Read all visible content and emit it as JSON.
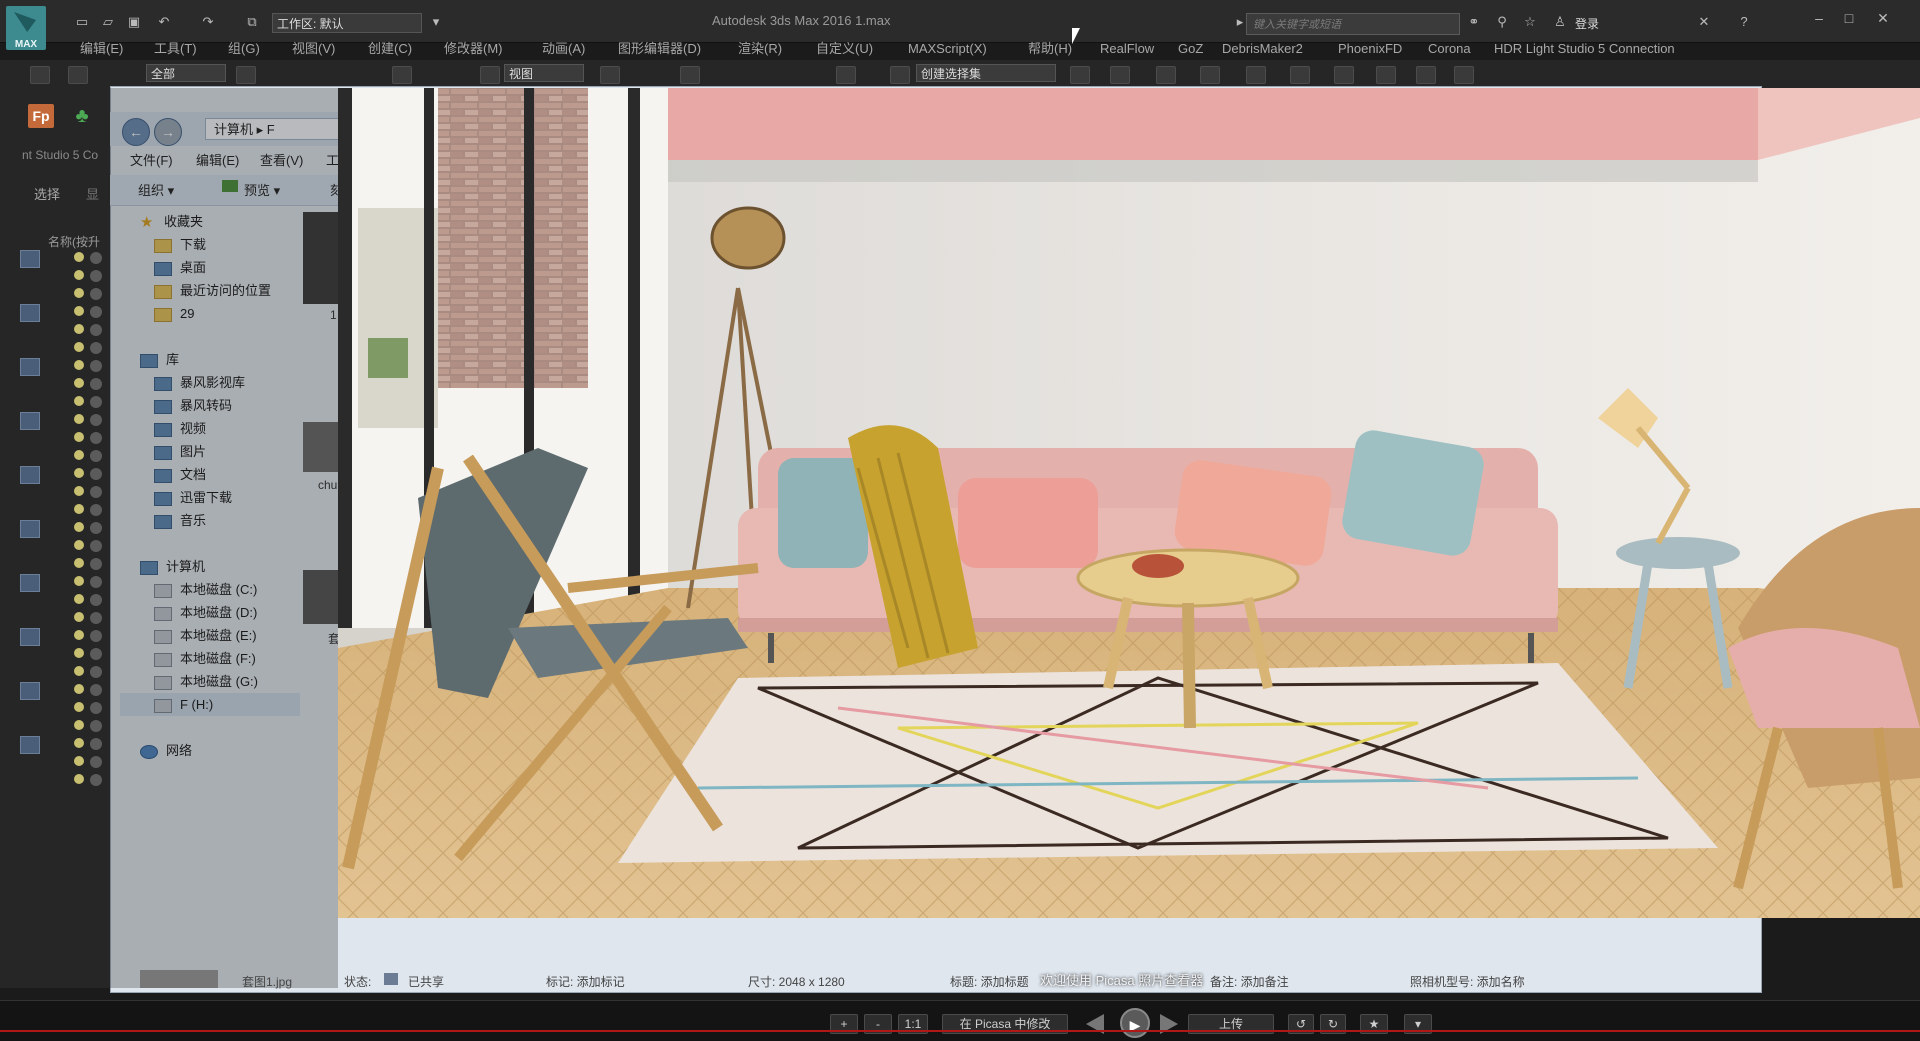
{
  "app": {
    "logo_text": "MAX",
    "workspace": "工作区: 默认",
    "window_title": "Autodesk 3ds Max 2016    1.max",
    "search_placeholder": "键入关键字或短语",
    "login": "登录",
    "menus": [
      "编辑(E)",
      "工具(T)",
      "组(G)",
      "视图(V)",
      "创建(C)",
      "修改器(M)",
      "动画(A)",
      "图形编辑器(D)",
      "渲染(R)",
      "自定义(U)",
      "MAXScript(X)",
      "帮助(H)",
      "RealFlow",
      "GoZ",
      "DebrisMaker2",
      "PhoenixFD",
      "Corona",
      "HDR Light Studio 5 Connection"
    ],
    "toolbar": {
      "selection_filter": "全部",
      "ref_coord": "视图",
      "named_selection": "创建选择集"
    },
    "left_panel": {
      "fp_label": "Fp",
      "side_label": "nt Studio 5 Co",
      "tab_select": "选择",
      "tab_display": "显",
      "name_column": "名称(按升"
    }
  },
  "explorer": {
    "path": "计算机 ▸ F",
    "menus": [
      "文件(F)",
      "编辑(E)",
      "查看(V)",
      "工"
    ],
    "toolbar": {
      "organize": "组织 ▾",
      "preview": "预览 ▾",
      "extra": "刻"
    },
    "favorites_header": "收藏夹",
    "favorites": [
      "下载",
      "桌面",
      "最近访问的位置",
      "29"
    ],
    "library_header": "库",
    "libraries": [
      "暴风影视库",
      "暴风转码",
      "视频",
      "图片",
      "文档",
      "迅雷下载",
      "音乐"
    ],
    "computer_header": "计算机",
    "drives": [
      "本地磁盘 (C:)",
      "本地磁盘 (D:)",
      "本地磁盘 (E:)",
      "本地磁盘 (F:)",
      "本地磁盘 (G:)",
      "F (H:)"
    ],
    "network": "网络",
    "thumb_captions": [
      "1",
      "chu",
      "套"
    ]
  },
  "picasa": {
    "caption": "欢迎使用 Picasa 照片查看器",
    "status": {
      "filename": "套图1.jpg",
      "state_label": "状态:",
      "state_value": "已共享",
      "tag": "标记: 添加标记",
      "size": "尺寸: 2048 x 1280",
      "title": "标题: 添加标题",
      "note": "备注: 添加备注",
      "camera": "照相机型号: 添加名称"
    },
    "controls": {
      "zoom_in": "+",
      "zoom_out": "-",
      "actual": "1:1",
      "edit_in_picasa": "在 Picasa 中修改",
      "upload": "上传",
      "play": "▶",
      "rotate_left": "↺",
      "rotate_right": "↻",
      "star": "★",
      "more": "▾"
    }
  },
  "colors": {
    "wall_pink": "#e9a7a7",
    "sofa_pink": "#e7b7b2",
    "throw_yellow": "#c4a42e",
    "floor_wood": "#d9b57e",
    "max_teal": "#3d8a8f"
  }
}
